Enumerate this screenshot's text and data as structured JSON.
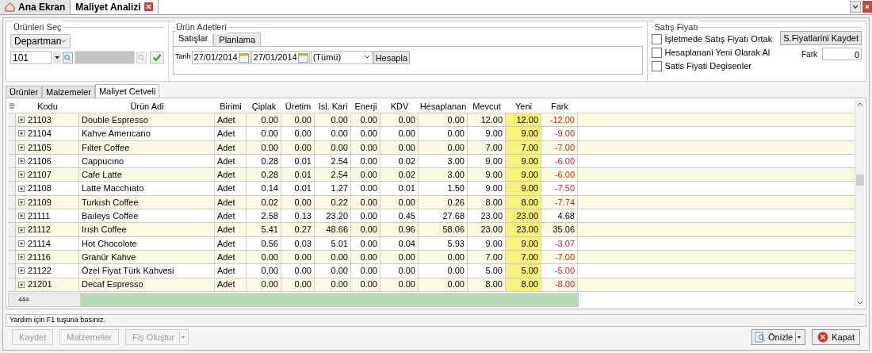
{
  "doc_tabs": [
    {
      "label": "Ana Ekran",
      "selected": false,
      "closable": false
    },
    {
      "label": "Maliyet Analizi",
      "selected": true,
      "closable": true
    }
  ],
  "urunleri_sec": {
    "title": "Ürünleri Seç",
    "group_select": "Departman",
    "code_value": "101"
  },
  "urun_adetleri": {
    "title": "Ürün Adetleri",
    "tabs": [
      {
        "label": "Satışlar",
        "selected": true
      },
      {
        "label": "Planlama",
        "selected": false
      }
    ],
    "date_label": "Tarih",
    "date_from": "27/01/2014",
    "date_to": "27/01/2014",
    "filter": "(Tümü)",
    "calc_button": "Hesapla"
  },
  "satis_fiyati": {
    "title": "Satış Fiyatı",
    "options": [
      {
        "label": "İşletmede Satış Fiyatı Ortak",
        "checked": false
      },
      {
        "label": "Hesaplanani Yeni Olarak Al",
        "checked": false
      },
      {
        "label": "Satis Fiyati Degisenler",
        "checked": false
      }
    ],
    "save_button": "S.Fiyatlarini Kaydet",
    "fark_label": "Fark",
    "fark_value": "0"
  },
  "sub_tabs": [
    {
      "label": "Ürünler",
      "selected": false
    },
    {
      "label": "Malzemeler",
      "selected": false
    },
    {
      "label": "Maliyet Cetveli",
      "selected": true
    }
  ],
  "table": {
    "columns": [
      "Kodu",
      "Ürün Adi",
      "Birimi",
      "Çiplak",
      "Üretim",
      "Isl. Kari",
      "Enerji",
      "KDV",
      "Hesaplanan",
      "Mevcut",
      "Yeni",
      "Fark"
    ],
    "rows": [
      {
        "cells": [
          "21103",
          "Double Espresso",
          "Adet",
          "0.00",
          "0.00",
          "0.00",
          "0.00",
          "0.00",
          "0.00",
          "12.00",
          "12.00",
          "-12.00"
        ],
        "negative": true
      },
      {
        "cells": [
          "21104",
          "Kahve Amerıcano",
          "Adet",
          "0.00",
          "0.00",
          "0.00",
          "0.00",
          "0.00",
          "0.00",
          "9.00",
          "9.00",
          "-9.00"
        ],
        "negative": true
      },
      {
        "cells": [
          "21105",
          "Fılter Coffee",
          "Adet",
          "0.00",
          "0.00",
          "0.00",
          "0.00",
          "0.00",
          "0.00",
          "7.00",
          "7.00",
          "-7.00"
        ],
        "negative": true
      },
      {
        "cells": [
          "21106",
          "Cappucıno",
          "Adet",
          "0.28",
          "0.01",
          "2.54",
          "0.00",
          "0.02",
          "3.00",
          "9.00",
          "9.00",
          "-6.00"
        ],
        "negative": true
      },
      {
        "cells": [
          "21107",
          "Cafe Latte",
          "Adet",
          "0.28",
          "0.01",
          "2.54",
          "0.00",
          "0.02",
          "3.00",
          "9.00",
          "9.00",
          "-6.00"
        ],
        "negative": true
      },
      {
        "cells": [
          "21108",
          "Latte Macchıato",
          "Adet",
          "0.14",
          "0.01",
          "1.27",
          "0.00",
          "0.01",
          "1.50",
          "9.00",
          "9.00",
          "-7.50"
        ],
        "negative": true
      },
      {
        "cells": [
          "21109",
          "Turkısh Coffee",
          "Adet",
          "0.02",
          "0.00",
          "0.22",
          "0.00",
          "0.00",
          "0.26",
          "8.00",
          "8.00",
          "-7.74"
        ],
        "negative": true
      },
      {
        "cells": [
          "21111",
          "Baıleys Coffee",
          "Adet",
          "2.58",
          "0.13",
          "23.20",
          "0.00",
          "0.45",
          "27.68",
          "23.00",
          "23.00",
          "4.68"
        ],
        "negative": false
      },
      {
        "cells": [
          "21112",
          "Irısh Coffee",
          "Adet",
          "5.41",
          "0.27",
          "48.66",
          "0.00",
          "0.96",
          "58.06",
          "23.00",
          "23.00",
          "35.06"
        ],
        "negative": false
      },
      {
        "cells": [
          "21114",
          "Hot Chocolote",
          "Adet",
          "0.56",
          "0.03",
          "5.01",
          "0.00",
          "0.04",
          "5.93",
          "9.00",
          "9.00",
          "-3.07"
        ],
        "negative": true
      },
      {
        "cells": [
          "21116",
          "Granür Kahve",
          "Adet",
          "0.00",
          "0.00",
          "0.00",
          "0.00",
          "0.00",
          "0.00",
          "7.00",
          "7.00",
          "-7.00"
        ],
        "negative": true
      },
      {
        "cells": [
          "21122",
          "Özel Fiyat Türk Kahvesi",
          "Adet",
          "0.00",
          "0.00",
          "0.00",
          "0.00",
          "0.00",
          "0.00",
          "5.00",
          "5.00",
          "-5.00"
        ],
        "negative": true
      },
      {
        "cells": [
          "21201",
          "Decaf Espresso",
          "Adet",
          "0.00",
          "0.00",
          "0.00",
          "0.00",
          "0.00",
          "0.00",
          "8.00",
          "8.00",
          "-8.00"
        ],
        "negative": true
      }
    ],
    "footer_count": "444"
  },
  "status_bar": "Yardım için F1 tuşuna basınız.",
  "bottom_buttons": [
    {
      "label": "Kaydet",
      "disabled": true,
      "kind": "plain"
    },
    {
      "label": "Malzemeler",
      "disabled": true,
      "kind": "plain"
    },
    {
      "label": "Fiş Oluştur",
      "disabled": true,
      "kind": "split"
    }
  ],
  "preview_button": "Önizle",
  "close_button": "Kapat"
}
